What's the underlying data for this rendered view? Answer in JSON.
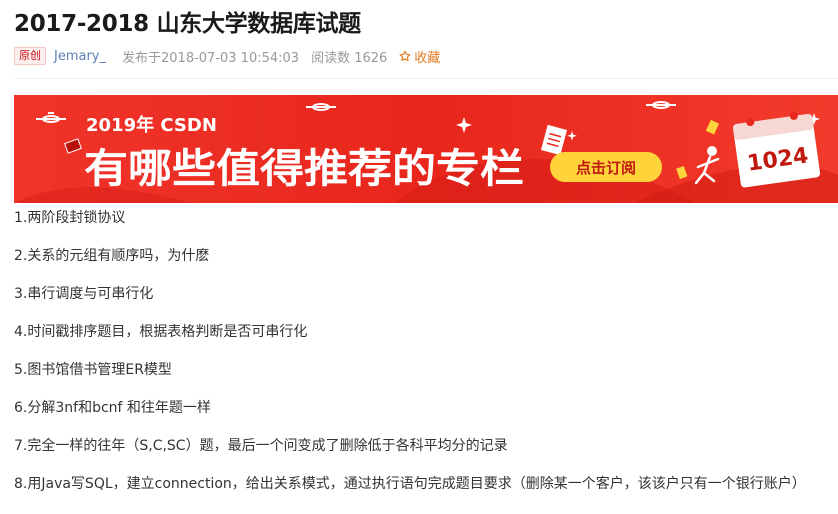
{
  "article": {
    "title": "2017-2018 山东大学数据库试题",
    "badge": "原创",
    "author": "Jemary_",
    "published": "发布于2018-07-03 10:54:03",
    "reads": "阅读数 1626",
    "favorite_label": "收藏"
  },
  "banner": {
    "year_text": "2019年 CSDN",
    "headline": "有哪些值得推荐的专栏",
    "cta_label": "点击订阅",
    "calendar_number": "1024",
    "colors": {
      "background": "#e8261c",
      "cta": "#ffd43b",
      "cta_text": "#c0170f"
    }
  },
  "content": {
    "items": [
      "1.两阶段封锁协议",
      "2.关系的元组有顺序吗，为什麽",
      "3.串行调度与可串行化",
      "4.时间戳排序题目，根据表格判断是否可串行化",
      "5.图书馆借书管理ER模型",
      "6.分解3nf和bcnf 和往年题一样",
      "7.完全一样的往年（S,C,SC）题，最后一个问变成了删除低于各科平均分的记录",
      "8.用Java写SQL，建立connection，给出关系模式，通过执行语句完成题目要求（删除某一个客户，该该户只有一个银行账户）"
    ]
  }
}
